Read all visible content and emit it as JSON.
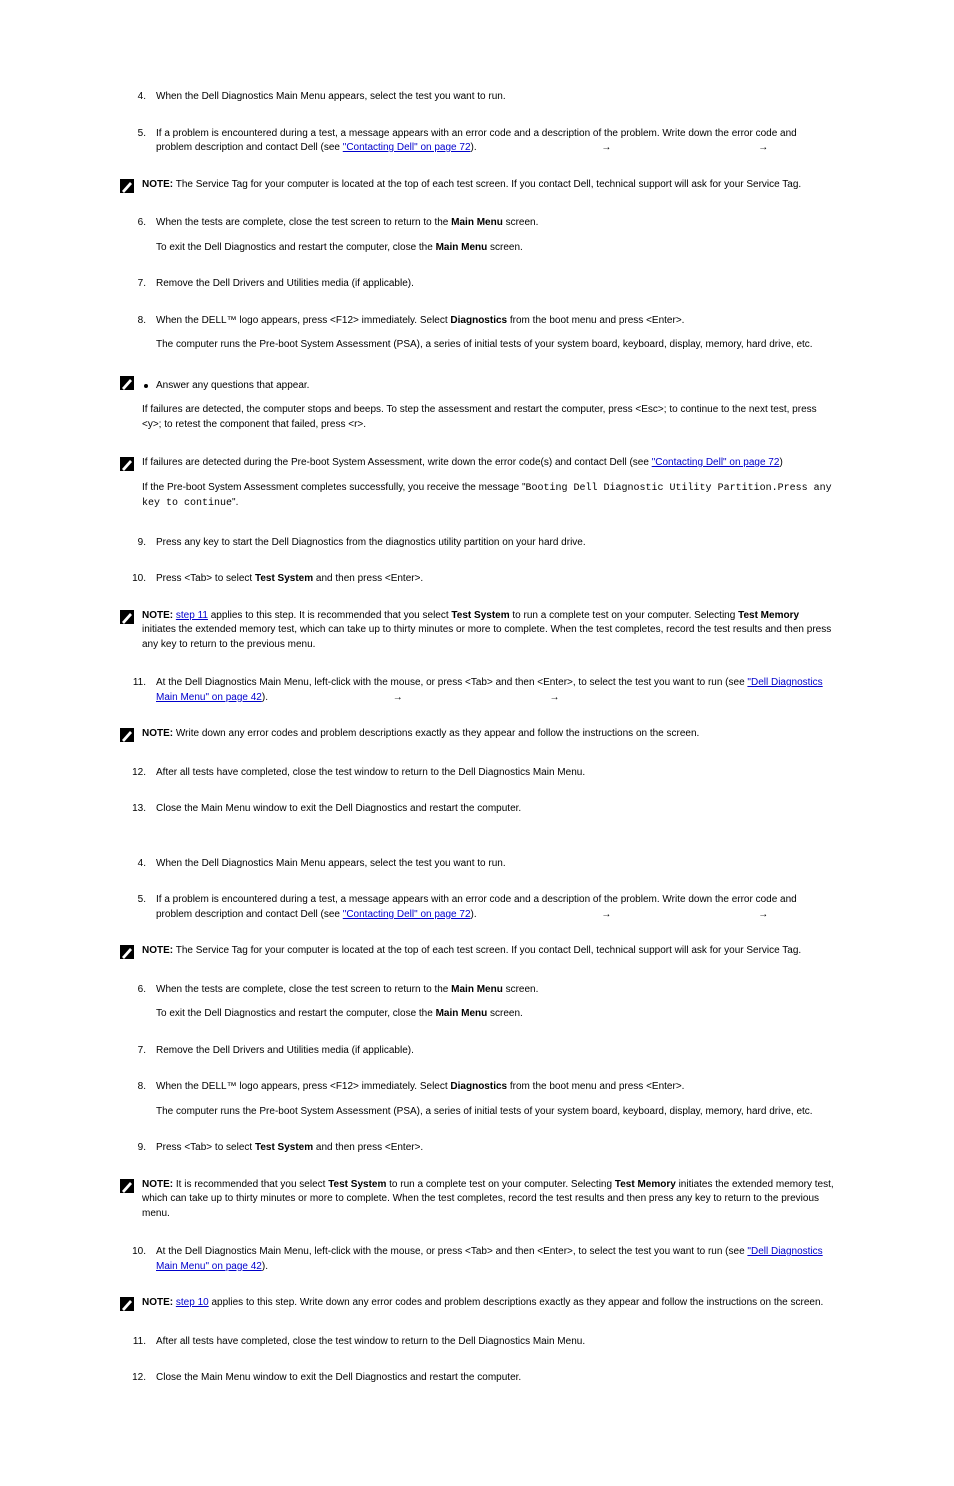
{
  "arrow_char": "→",
  "note_label": "NOTE:",
  "sectionA": {
    "steps": {
      "s4": {
        "n": "4.",
        "p1": "When the Dell Diagnostics Main Menu appears, select the test you want to run."
      },
      "s5": {
        "n": "5.",
        "p1a": "If a problem is encountered during a test, a message appears with an error code and a description of the problem. Write down the error code and problem description and contact Dell (see ",
        "link": "\"Contacting Dell\" on page 72",
        "p1b": ")."
      },
      "note5": {
        "p1": "The Service Tag for your computer is located at the top of each test screen. If you contact Dell, technical support will ask for your Service Tag."
      },
      "s6": {
        "n": "6.",
        "p1a": "When the tests are complete, close the test screen to return to the ",
        "bold1": "Main Menu",
        "p1b": " screen.",
        "p2a": "To exit the Dell Diagnostics and restart the computer, close the ",
        "bold2": "Main Menu",
        "p2b": " screen."
      },
      "s7": {
        "n": "7.",
        "p1": "Remove the Dell Drivers and Utilities media (if applicable)."
      },
      "s8": {
        "n": "8.",
        "p1a": "When the DELL™ logo appears, press <F12> immediately. Select ",
        "bold1": "Diagnostics",
        "p1b": " from the boot menu and press <Enter>.",
        "p2": "The computer runs the Pre-boot System Assessment (PSA), a series of initial tests of your system board, keyboard, display, memory, hard drive, etc."
      },
      "note8a": {
        "b1": "Answer any questions that appear."
      },
      "note8b": {
        "prefix": "If failures are detected, the computer stops and beeps. To step the assessment and restart the computer, press <Esc>; to continue to the next test, press <y>; to retest the component that failed, press <r>."
      },
      "note8c": {
        "p1a": "If failures are detected during the Pre-boot System Assessment, write down the error code(s) and contact Dell (see ",
        "link": "\"Contacting Dell\" on page 72",
        "p1b": ")"
      },
      "note8d": {
        "prefix": "If the Pre-boot System Assessment completes successfully, you receive the message \"",
        "mono": "Booting Dell Diagnostic Utility Partition.Press any key to continue",
        "suffix": "\"."
      },
      "s9": {
        "n": "9.",
        "p1": "Press any key to start the Dell Diagnostics from the diagnostics utility partition on your hard drive."
      },
      "s10": {
        "n": "10.",
        "p1a": "Press <Tab> to select ",
        "bold1": "Test System",
        "p1b": " and then press <Enter>."
      },
      "note10": {
        "p1a": "It is recommended that you select ",
        "bold1": "Test System",
        "p1b": " to run a complete test on your computer. Selecting ",
        "bold2": "Test Memory",
        "p1c": " initiates the extended memory test, which can take up to thirty minutes or more to complete. When the test completes, record the test results and then press any key to return to the previous menu."
      },
      "s11": {
        "n": "11.",
        "p1a": "At the Dell Diagnostics Main Menu, left-click with the mouse, or press <Tab> and then <Enter>, to select the test you want to run (see ",
        "link": "\"Dell Diagnostics Main Menu\" on page 42",
        "p1b": ")."
      },
      "note11": {
        "p1": "Write down any error codes and problem descriptions exactly as they appear and follow the instructions on the screen."
      },
      "s12": {
        "n": "12.",
        "p1": "After all tests have completed, close the test window to return to the Dell Diagnostics Main Menu."
      },
      "s13": {
        "n": "13.",
        "p1": "Close the Main Menu window to exit the Dell Diagnostics and restart the computer."
      },
      "step11_xref_note": {
        "link": "step 11",
        "rest": " applies to this step."
      }
    }
  },
  "sectionB": {
    "steps": {
      "s4b": {
        "n": "4.",
        "p1": "When the Dell Diagnostics Main Menu appears, select the test you want to run."
      },
      "s5b": {
        "n": "5.",
        "p1a": "If a problem is encountered during a test, a message appears with an error code and a description of the problem. Write down the error code and problem description and contact Dell (see ",
        "link": "\"Contacting Dell\" on page 72",
        "p1b": ")."
      },
      "note5b": {
        "p1": "The Service Tag for your computer is located at the top of each test screen. If you contact Dell, technical support will ask for your Service Tag."
      },
      "s6b": {
        "n": "6.",
        "p1a": "When the tests are complete, close the test screen to return to the ",
        "bold1": "Main Menu",
        "p1b": " screen.",
        "p2a": "To exit the Dell Diagnostics and restart the computer, close the ",
        "bold2": "Main Menu",
        "p2b": " screen."
      },
      "s7b": {
        "n": "7.",
        "p1": "Remove the Dell Drivers and Utilities media (if applicable)."
      },
      "s8b": {
        "n": "8.",
        "p1a": "When the DELL™ logo appears, press <F12> immediately. Select ",
        "bold1": "Diagnostics",
        "p1b": " from the boot menu and press <Enter>.",
        "p2": "The computer runs the Pre-boot System Assessment (PSA), a series of initial tests of your system board, keyboard, display, memory, hard drive, etc."
      },
      "s9b": {
        "n": "9.",
        "p1a": "Press <Tab> to select ",
        "bold1": "Test System",
        "p1b": " and then press <Enter>."
      },
      "note9b": {
        "p1a": "It is recommended that you select ",
        "bold1": "Test System",
        "p1b": " to run a complete test on your computer. Selecting ",
        "bold2": "Test Memory",
        "p1c": " initiates the extended memory test, which can take up to thirty minutes or more to complete. When the test completes, record the test results and then press any key to return to the previous menu."
      },
      "s10b": {
        "n": "10.",
        "p1a": "At the Dell Diagnostics Main Menu, left-click with the mouse, or press <Tab> and then <Enter>, to select the test you want to run (see ",
        "link": "\"Dell Diagnostics Main Menu\" on page 42",
        "p1b": ")."
      },
      "note10b": {
        "p1": "Write down any error codes and problem descriptions exactly as they appear and follow the instructions on the screen."
      },
      "step10_xref_note": {
        "link": "step 10",
        "rest": " applies to this step."
      },
      "s11b": {
        "n": "11.",
        "p1": "After all tests have completed, close the test window to return to the Dell Diagnostics Main Menu."
      },
      "s12b": {
        "n": "12.",
        "p1": "Close the Main Menu window to exit the Dell Diagnostics and restart the computer."
      }
    }
  }
}
